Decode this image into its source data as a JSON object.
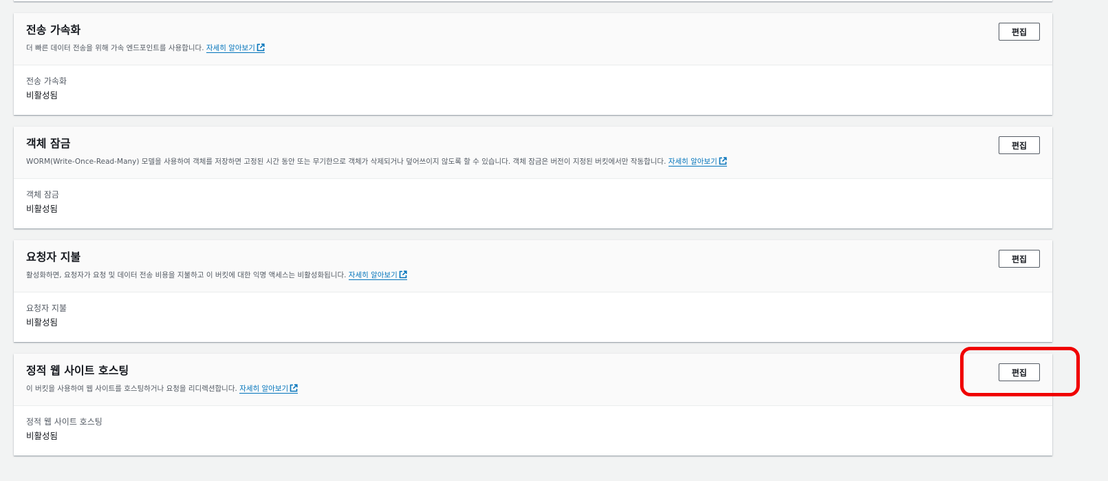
{
  "colors": {
    "page_background": "#f2f3f3",
    "panel_background": "#ffffff",
    "header_background": "#fafafa",
    "link": "#0073bb",
    "highlight": "#f00000"
  },
  "panels": [
    {
      "title": "전송 가속화",
      "description": "더 빠른 데이터 전송을 위해 가속 엔드포인트를 사용합니다.",
      "link_text": "자세히 알아보기",
      "edit_label": "편집",
      "field_label": "전송 가속화",
      "field_value": "비활성됨"
    },
    {
      "title": "객체 잠금",
      "description": "WORM(Write-Once-Read-Many) 모델을 사용하여 객체를 저장하면 고정된 시간 동안 또는 무기한으로 객체가 삭제되거나 덮어쓰이지 않도록 할 수 있습니다. 객체 잠금은 버전이 지정된 버킷에서만 작동합니다.",
      "link_text": "자세히 알아보기",
      "edit_label": "편집",
      "field_label": "객체 잠금",
      "field_value": "비활성됨"
    },
    {
      "title": "요청자 지불",
      "description": "활성화하면, 요청자가 요청 및 데이터 전송 비용을 지불하고 이 버킷에 대한 익명 액세스는 비활성화됩니다.",
      "link_text": "자세히 알아보기",
      "edit_label": "편집",
      "field_label": "요청자 지불",
      "field_value": "비활성됨"
    },
    {
      "title": "정적 웹 사이트 호스팅",
      "description": "이 버킷을 사용하여 웹 사이트를 호스팅하거나 요청을 리디렉션합니다.",
      "link_text": "자세히 알아보기",
      "edit_label": "편집",
      "field_label": "정적 웹 사이트 호스팅",
      "field_value": "비활성됨"
    }
  ],
  "icons": {
    "external_link": "external-link-icon"
  }
}
